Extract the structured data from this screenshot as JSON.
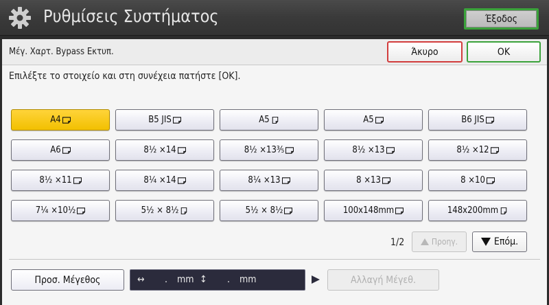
{
  "titlebar": {
    "title": "Ρυθμίσεις Συστήματος",
    "exit_label": "Έξοδος"
  },
  "subheader": {
    "title": "Μέγ. Χαρτ. Bypass Εκτυπ.",
    "cancel_label": "Άκυρο",
    "ok_label": "OK"
  },
  "instruction": "Επιλέξτε το στοιχείο και στη συνέχεια πατήστε [OK].",
  "sizes": [
    {
      "label": "A4",
      "orient": "landscape",
      "selected": true
    },
    {
      "label": "B5 JIS",
      "orient": "landscape"
    },
    {
      "label": "A5",
      "orient": "portrait"
    },
    {
      "label": "A5",
      "orient": "landscape"
    },
    {
      "label": "B6 JIS",
      "orient": "landscape"
    },
    {
      "label": "A6",
      "orient": "landscape"
    },
    {
      "label": "8½ ×14",
      "orient": "landscape"
    },
    {
      "label": "8½ ×13⅗",
      "orient": "landscape"
    },
    {
      "label": "8½ ×13",
      "orient": "landscape"
    },
    {
      "label": "8½ ×12",
      "orient": "landscape"
    },
    {
      "label": "8½ ×11",
      "orient": "landscape"
    },
    {
      "label": "8¼ ×14",
      "orient": "landscape"
    },
    {
      "label": "8¼ ×13",
      "orient": "landscape"
    },
    {
      "label": "8 ×13",
      "orient": "landscape"
    },
    {
      "label": "8 ×10",
      "orient": "landscape"
    },
    {
      "label": "7¼ ×10½",
      "orient": "landscape"
    },
    {
      "label": "5½ × 8½",
      "orient": "portrait"
    },
    {
      "label": "5½ × 8½",
      "orient": "landscape"
    },
    {
      "label": "100x148mm",
      "orient": "landscape"
    },
    {
      "label": "148x200mm",
      "orient": "portrait"
    }
  ],
  "pagination": {
    "indicator": "1/2",
    "prev_label": "Προηγ.",
    "next_label": "Επόμ."
  },
  "custom": {
    "button_label": "Προσ. Μέγεθος",
    "horiz_symbol": "↔",
    "horiz_value": ".",
    "unit1": "mm",
    "vert_symbol": "↕",
    "vert_value": ".",
    "unit2": "mm",
    "change_label": "Αλλαγή Μέγεθ."
  },
  "colors": {
    "selected": "#f2c000",
    "ok_border": "#3aa23a",
    "cancel_border": "#d23c3c"
  }
}
